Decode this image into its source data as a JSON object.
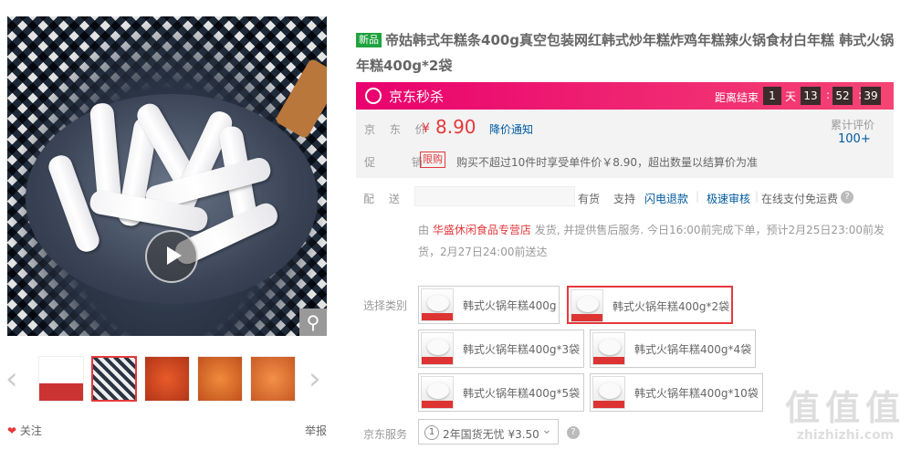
{
  "product": {
    "new_tag": "新品",
    "title": "帝姑韩式年糕条400g真空包装网红韩式炒年糕炸鸡年糕辣火锅食材白年糕 韩式火锅年糕400g*2袋"
  },
  "seckill": {
    "label": "京东秒杀",
    "countdown_label": "距离结束",
    "days": "1",
    "day_unit": "天",
    "hours": "13",
    "minutes": "52",
    "seconds": "39"
  },
  "price": {
    "label": "京 东 价",
    "currency": "¥",
    "value": "8.90",
    "notify_link": "降价通知",
    "reviews_label": "累计评价",
    "reviews_count": "100+"
  },
  "promo": {
    "label": "促 销",
    "tag": "限购",
    "text": "购买不超过10件时享受单件价￥8.90，超出数量以结算价为准"
  },
  "delivery": {
    "label": "配 送 至",
    "stock": "有货",
    "support": "支持",
    "service1": "闪电退款",
    "service2": "极速审核",
    "service3": "在线支付免运费",
    "line1_prefix": "由",
    "shop": "华盛休闲食品专营店",
    "line1_rest": "发货, 并提供售后服务. 今日16:00前完成下单，预计2月25日23:00前发",
    "line2": "货，2月27日24:00前送达"
  },
  "variants": {
    "label": "选择类别",
    "options": [
      "韩式火锅年糕400g",
      "韩式火锅年糕400g*2袋",
      "韩式火锅年糕400g*3袋",
      "韩式火锅年糕400g*4袋",
      "韩式火锅年糕400g*5袋",
      "韩式火锅年糕400g*10袋"
    ],
    "selected_index": 1
  },
  "jd_service": {
    "label": "京东服务",
    "option_badge": "1",
    "option_text": "2年国货无忧 ¥3.50"
  },
  "gallery": {
    "follow": "关注",
    "report": "举报"
  },
  "watermark": {
    "text_big": "值值值",
    "text_small": "zhizhizhi.com"
  },
  "colors": {
    "accent_red": "#e4393c",
    "seckill_pink": "#e9006e",
    "link_blue": "#005aa0",
    "new_green": "#1fa33e"
  }
}
